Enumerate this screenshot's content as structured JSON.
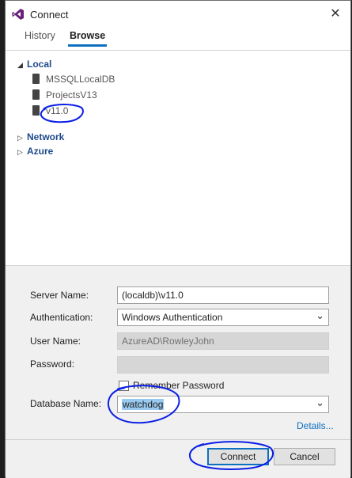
{
  "window": {
    "title": "Connect",
    "close_label": "✕"
  },
  "tabs": [
    {
      "label": "History"
    },
    {
      "label": "Browse"
    }
  ],
  "tree": {
    "local": {
      "label": "Local",
      "children": [
        {
          "label": "MSSQLLocalDB"
        },
        {
          "label": "ProjectsV13"
        },
        {
          "label": "v11.0"
        }
      ]
    },
    "network": {
      "label": "Network"
    },
    "azure": {
      "label": "Azure"
    }
  },
  "form": {
    "server_name_label": "Server Name:",
    "server_name_value": "(localdb)\\v11.0",
    "authentication_label": "Authentication:",
    "authentication_value": "Windows Authentication",
    "user_name_label": "User Name:",
    "user_name_value": "AzureAD\\RowleyJohn",
    "password_label": "Password:",
    "password_value": "",
    "remember_password_label": "Remember Password",
    "database_name_label": "Database Name:",
    "database_name_value": "watchdog",
    "details_link": "Details..."
  },
  "buttons": {
    "connect": "Connect",
    "cancel": "Cancel"
  },
  "icons": {
    "app": "visual-studio-icon",
    "expanded": "triangle-down-icon",
    "collapsed": "triangle-right-icon",
    "database": "database-icon",
    "dropdown": "chevron-down-icon"
  },
  "colors": {
    "accent": "#0e70c0",
    "annotation": "#0a1ee6",
    "selection": "#99c9ef"
  }
}
